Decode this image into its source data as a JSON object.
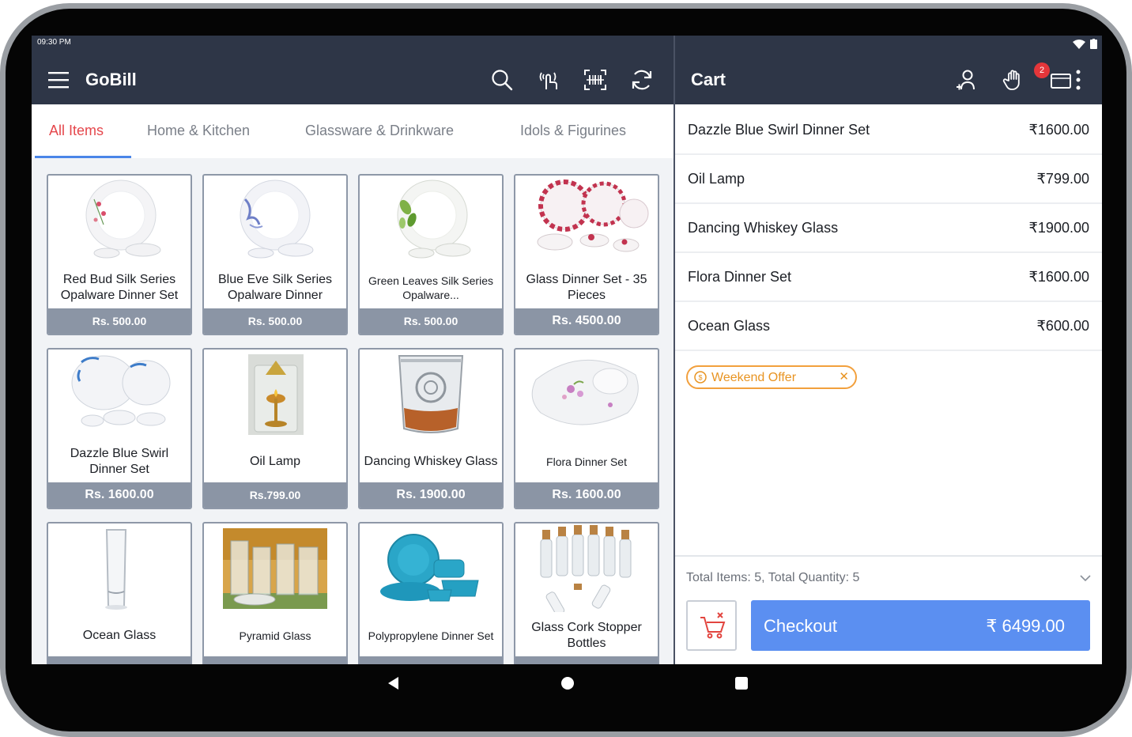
{
  "status": {
    "time": "09:30 PM"
  },
  "header": {
    "app_title": "GoBill",
    "cart_title": "Cart",
    "notification_count": "2"
  },
  "icons": {
    "menu": "hamburger-icon",
    "search": "search-icon",
    "touch": "touch-tap-icon",
    "barcode": "barcode-scan-icon",
    "sync": "refresh-icon",
    "customer": "add-customer-icon",
    "hold": "hand-hold-icon",
    "orders": "orders-icon",
    "more": "more-vertical-icon"
  },
  "tabs": [
    {
      "label": "All Items",
      "active": true
    },
    {
      "label": "Home & Kitchen"
    },
    {
      "label": "Glassware & Drinkware"
    },
    {
      "label": "Idols & Figurines"
    }
  ],
  "products": [
    {
      "name": "Red Bud Silk Series Opalware Dinner Set",
      "price": "Rs. 500.00"
    },
    {
      "name": "Blue Eve Silk Series Opalware Dinner",
      "price": "Rs. 500.00"
    },
    {
      "name": "Green Leaves Silk Series Opalware...",
      "price": "Rs. 500.00"
    },
    {
      "name": "Glass Dinner Set - 35 Pieces",
      "price": "Rs. 4500.00"
    },
    {
      "name": "Dazzle Blue Swirl Dinner Set",
      "price": "Rs. 1600.00"
    },
    {
      "name": "Oil Lamp",
      "price": "Rs.799.00"
    },
    {
      "name": "Dancing Whiskey Glass",
      "price": "Rs. 1900.00"
    },
    {
      "name": "Flora Dinner Set",
      "price": "Rs. 1600.00"
    },
    {
      "name": "Ocean Glass",
      "price": ""
    },
    {
      "name": "Pyramid Glass",
      "price": ""
    },
    {
      "name": "Polypropylene Dinner Set",
      "price": ""
    },
    {
      "name": "Glass Cork Stopper Bottles",
      "price": ""
    }
  ],
  "cart": {
    "items": [
      {
        "name": "Dazzle Blue Swirl Dinner Set",
        "price": "₹1600.00"
      },
      {
        "name": "Oil Lamp",
        "price": "₹799.00"
      },
      {
        "name": "Dancing Whiskey Glass",
        "price": "₹1900.00"
      },
      {
        "name": "Flora Dinner Set",
        "price": "₹1600.00"
      },
      {
        "name": "Ocean Glass",
        "price": "₹600.00"
      }
    ],
    "offer": "Weekend Offer",
    "summary": "Total Items: 5, Total Quantity: 5",
    "checkout_label": "Checkout",
    "checkout_total": "₹ 6499.00"
  },
  "colors": {
    "header": "#2e3647",
    "accent_tab": "#e5474c",
    "checkout": "#5b8ff1",
    "offer": "#f2a03d",
    "price_bar": "#8b95a5"
  }
}
